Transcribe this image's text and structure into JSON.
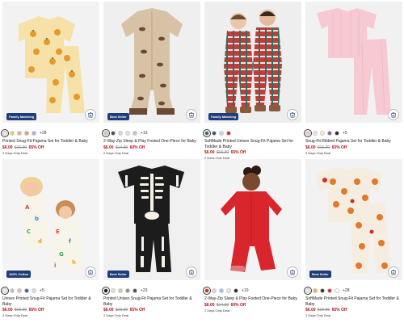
{
  "colors": {
    "sale_red": "#b5121b",
    "badge_navy": "#1f3d7a"
  },
  "products": [
    {
      "badge": "Family Matching",
      "swatch_colors": [
        "#e8e8e8",
        "#f0d36b",
        "#d9b391",
        "#e7a24d",
        "#9cb8de"
      ],
      "more": "+28",
      "title": "Printed Snug-Fit Pajama Set for Toddler & Baby",
      "price": "$6.00",
      "was": "$16.99",
      "off": "65% Off",
      "deal": "2 Days Only Deal"
    },
    {
      "badge": "Best Seller",
      "swatch_colors": [
        "#d6c3a8",
        "#5c4433",
        "#cfd8e6",
        "#f2dcd8",
        "#b7c7e6"
      ],
      "more": "+19",
      "title": "2-Way-Zip Sleep & Play Footed One-Piece for Baby",
      "price": "$6.00",
      "was": "$14.99",
      "off": "60% Off",
      "deal": "2 Days Only Deal"
    },
    {
      "badge": "Family Matching",
      "swatch_colors": [
        "#2f6f5b",
        "#3a4b7a",
        "#cfd6e8",
        "#c9302c"
      ],
      "more": "",
      "title": "SoftMade Printed Unisex Snug-Fit Pajama Set for Toddler & Baby",
      "price": "$6.00",
      "was": "$16.99",
      "off": "65% Off",
      "deal": "2 Days Only Deal"
    },
    {
      "badge": "",
      "swatch_colors": [
        "#f6c7d0",
        "#e6e6e6",
        "#f5ead2",
        "#8a5f9e",
        "#2b2b2b"
      ],
      "more": "+5",
      "title": "Snug-Fit Ribbed Pajama Set for Toddler & Baby",
      "price": "$6.00",
      "was": "$16.99",
      "off": "65% Off",
      "deal": "2 Days Only Deal"
    },
    {
      "badge": "100% Cotton",
      "swatch_colors": [
        "#ededed",
        "#c9c2b2",
        "#e5b8c6",
        "#3b5ba8",
        "#d8dce8"
      ],
      "more": "+5",
      "title": "Unisex Printed Snug-Fit Pajama Set for Toddler & Baby",
      "price": "$6.00",
      "was": "$16.99",
      "off": "65% Off",
      "deal": "2 Days Only Deal"
    },
    {
      "badge": "Best Seller",
      "swatch_colors": [
        "#1c1c1c",
        "#e7e1d2",
        "#d9c2a7",
        "#8d8d8d",
        "#3d5c2f"
      ],
      "more": "+23",
      "title": "Printed Unisex Snug-Fit Pajama Set for Toddler & Baby",
      "price": "$6.00",
      "was": "$16.99",
      "off": "65% Off",
      "deal": "2 Days Only Deal"
    },
    {
      "badge": "",
      "swatch_colors": [
        "#d7262c",
        "#f2c8cf",
        "#9cc3e6",
        "#e8e3d8",
        "#2b2b2b"
      ],
      "more": "+19",
      "title": "2-Way-Zip Sleep & Play Footed One-Piece for Baby",
      "price": "$6.00",
      "was": "$14.99",
      "off": "60% Off",
      "deal": "2 Days Only Deal"
    },
    {
      "badge": "Best Seller",
      "swatch_colors": [
        "#f3ede2",
        "#e8b15a",
        "#2b2b2b",
        "#c9302c",
        "#ffffff"
      ],
      "more": "+28",
      "title": "SoftMade Printed Snug-Fit Pajama Set for Toddler & Baby",
      "price": "$6.00",
      "was": "$16.99",
      "off": "65% Off",
      "deal": "2 Days Only Deal"
    }
  ]
}
